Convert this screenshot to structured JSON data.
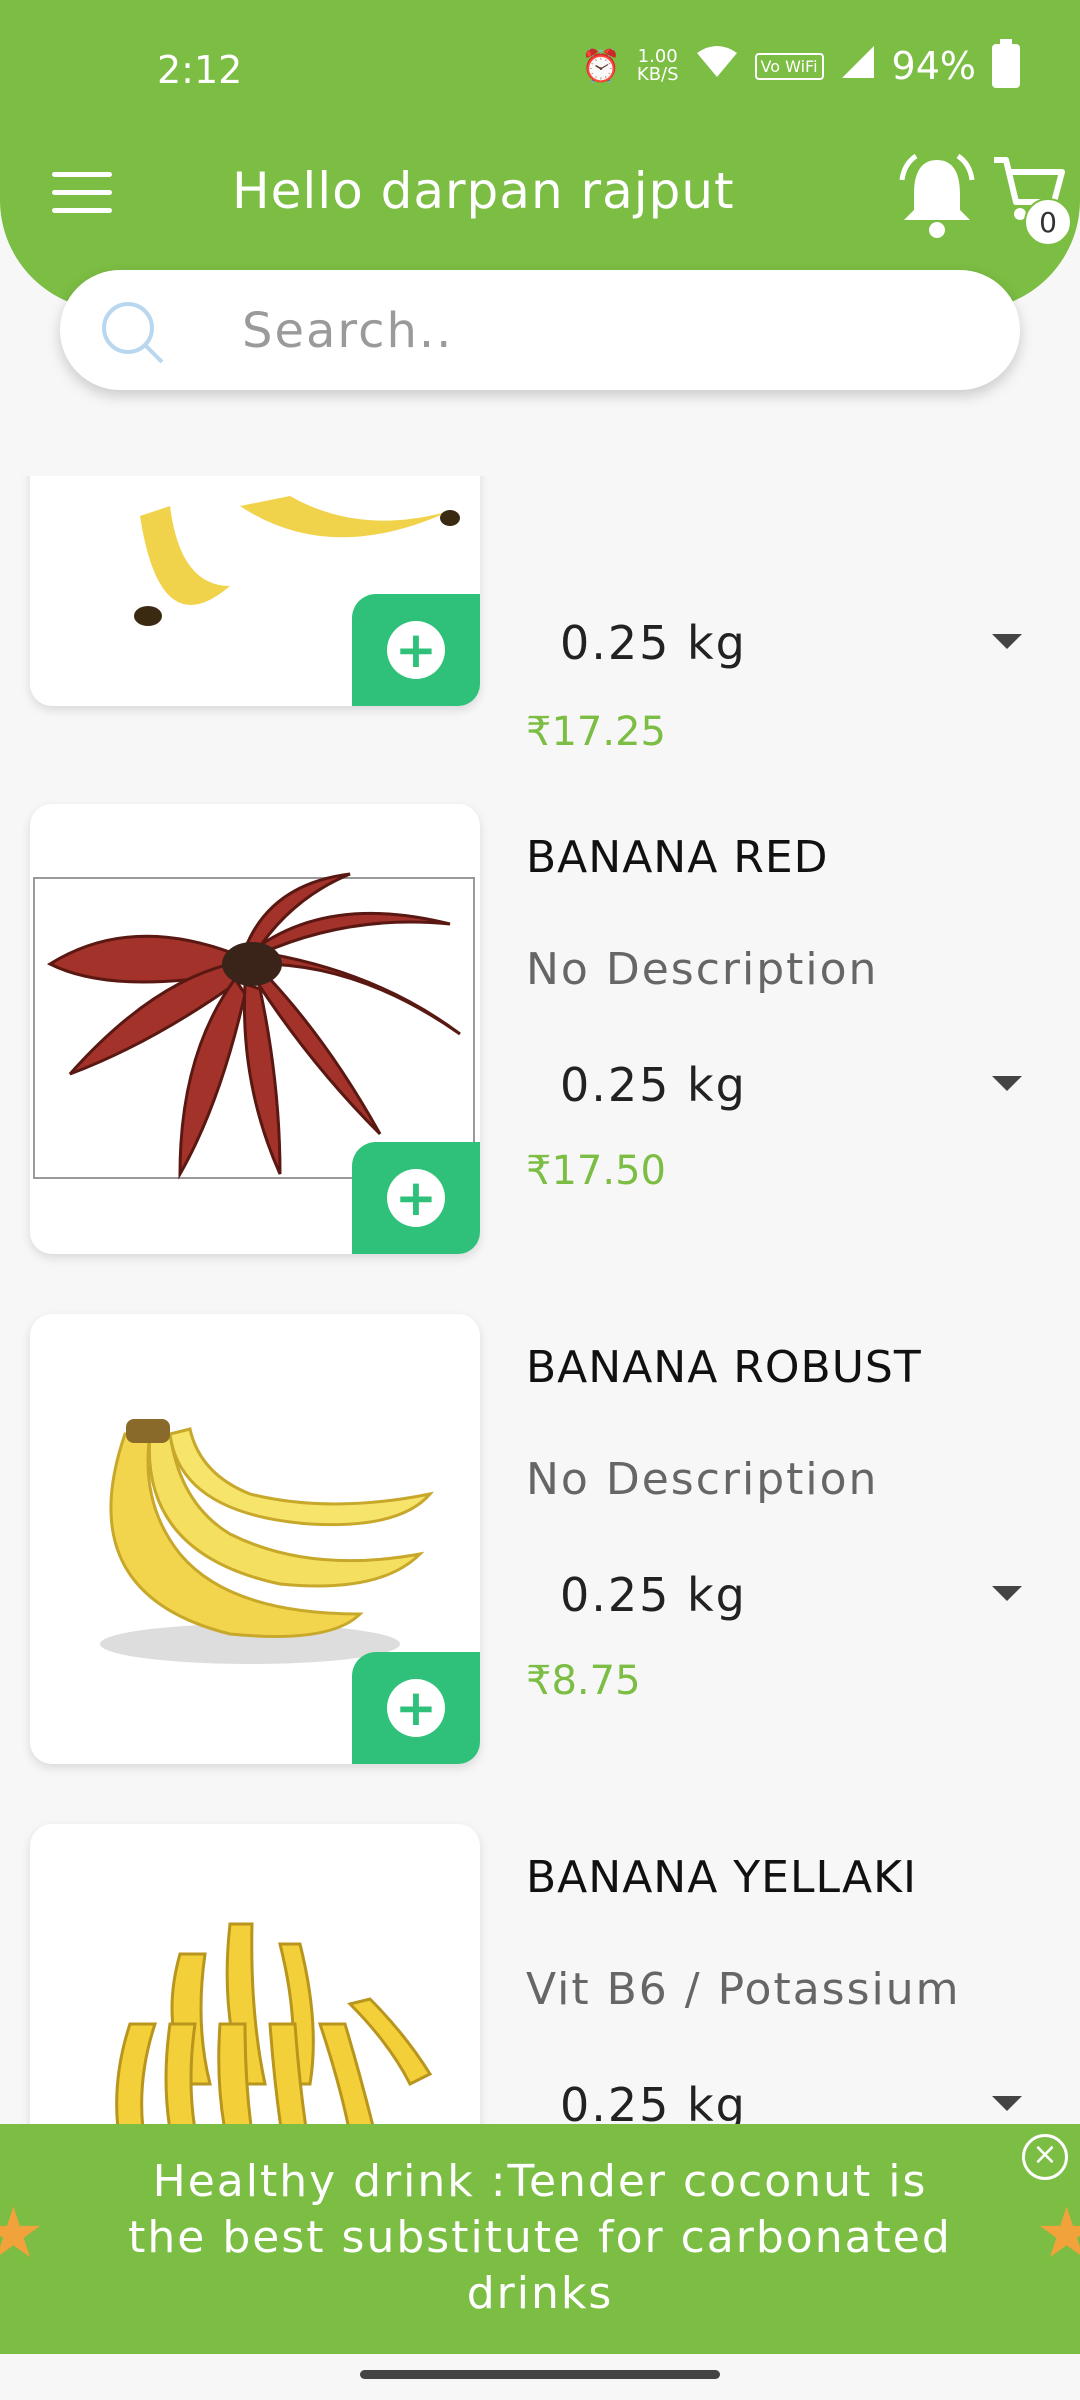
{
  "status": {
    "time": "2:12",
    "speed": "1.00\nKB/S",
    "volte": "Vo WiFi",
    "battery": "94%"
  },
  "header": {
    "greeting": "Hello darpan rajput",
    "cart_count": "0"
  },
  "search": {
    "placeholder": "Search.."
  },
  "products": [
    {
      "name": "",
      "description": "",
      "qty": "0.25 kg",
      "price": "₹17.25"
    },
    {
      "name": "BANANA RED",
      "description": "No Description",
      "qty": "0.25 kg",
      "price": "₹17.50"
    },
    {
      "name": "BANANA ROBUST",
      "description": "No Description",
      "qty": "0.25 kg",
      "price": "₹8.75"
    },
    {
      "name": "BANANA YELLAKI",
      "description": "Vit B6 / Potassium",
      "qty": "0.25 kg",
      "price": ""
    }
  ],
  "banner": {
    "text": "Healthy drink :Tender coconut is the best substitute for carbonated drinks"
  },
  "colors": {
    "brand": "#7cbd44",
    "add_button": "#2fc07a"
  }
}
